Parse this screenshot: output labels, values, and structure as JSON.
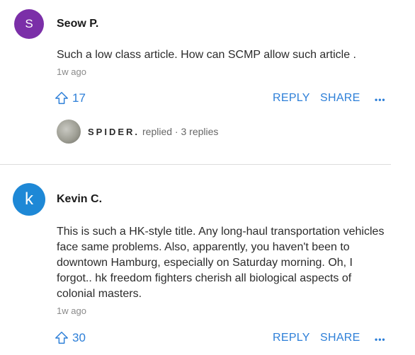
{
  "comments": [
    {
      "avatar_letter": "S",
      "avatar_color": "#7b2fa8",
      "author": "Seow P.",
      "text": "Such a low class article. How can SCMP allow such article .",
      "time": "1w ago",
      "likes": "17",
      "reply_label": "REPLY",
      "share_label": "SHARE",
      "more_label": "•••",
      "replies": {
        "author": "SPIDER.",
        "meta": "replied · 3 replies"
      }
    },
    {
      "avatar_letter": "k",
      "avatar_color": "#1e88d6",
      "author": "Kevin C.",
      "text": "This is such a HK-style title. Any long-haul transportation vehicles face same problems. Also, apparently, you haven't been to downtown Hamburg, especially on Saturday morning. Oh, I forgot.. hk freedom fighters cherish all biological aspects of colonial masters.",
      "time": "1w ago",
      "likes": "30",
      "reply_label": "REPLY",
      "share_label": "SHARE",
      "more_label": "•••"
    }
  ],
  "icons": {
    "like": "upvote-arrow-icon"
  },
  "colors": {
    "accent": "#2d7fd8"
  }
}
